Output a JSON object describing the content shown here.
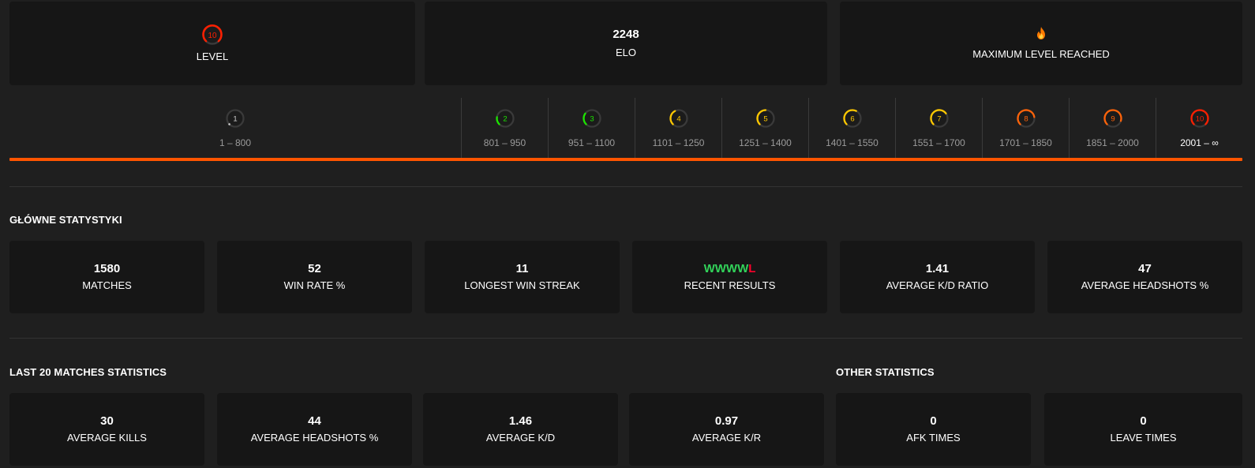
{
  "top_cards": {
    "level": {
      "badge": "10",
      "label": "LEVEL"
    },
    "elo": {
      "value": "2248",
      "label": "ELO"
    },
    "max": {
      "icon": "fire-icon",
      "label": "MAXIMUM LEVEL REACHED"
    }
  },
  "level_bar": {
    "segments": [
      {
        "level": "1",
        "range": "1 – 800",
        "color": "#cdcdcd"
      },
      {
        "level": "2",
        "range": "801 – 950",
        "color": "#1ce400"
      },
      {
        "level": "3",
        "range": "951 – 1100",
        "color": "#1ce400"
      },
      {
        "level": "4",
        "range": "1101 – 1250",
        "color": "#ffc800"
      },
      {
        "level": "5",
        "range": "1251 – 1400",
        "color": "#ffc800"
      },
      {
        "level": "6",
        "range": "1401 – 1550",
        "color": "#ffc800"
      },
      {
        "level": "7",
        "range": "1551 – 1700",
        "color": "#ffc800"
      },
      {
        "level": "8",
        "range": "1701 – 1850",
        "color": "#ff6309"
      },
      {
        "level": "9",
        "range": "1851 – 2000",
        "color": "#ff6309"
      },
      {
        "level": "10",
        "range": "2001 – ∞",
        "color": "#fe1f00"
      }
    ],
    "current_level": "10",
    "accent": "#ff5500"
  },
  "main_stats": {
    "title": "GŁÓWNE STATYSTYKI",
    "items": [
      {
        "value": "1580",
        "label": "MATCHES"
      },
      {
        "value": "52",
        "label": "WIN RATE %"
      },
      {
        "value": "11",
        "label": "LONGEST WIN STREAK"
      },
      {
        "value": "WWWWL",
        "label": "RECENT RESULTS"
      },
      {
        "value": "1.41",
        "label": "AVERAGE K/D RATIO"
      },
      {
        "value": "47",
        "label": "AVERAGE HEADSHOTS %"
      }
    ]
  },
  "last20": {
    "title": "LAST 20 MATCHES STATISTICS",
    "items": [
      {
        "value": "30",
        "label": "AVERAGE KILLS"
      },
      {
        "value": "44",
        "label": "AVERAGE HEADSHOTS %"
      },
      {
        "value": "1.46",
        "label": "AVERAGE K/D"
      },
      {
        "value": "0.97",
        "label": "AVERAGE K/R"
      }
    ]
  },
  "other": {
    "title": "OTHER STATISTICS",
    "items": [
      {
        "value": "0",
        "label": "AFK TIMES"
      },
      {
        "value": "0",
        "label": "LEAVE TIMES"
      }
    ]
  },
  "colors": {
    "win": "#32d35a",
    "loss": "#ff002b"
  }
}
